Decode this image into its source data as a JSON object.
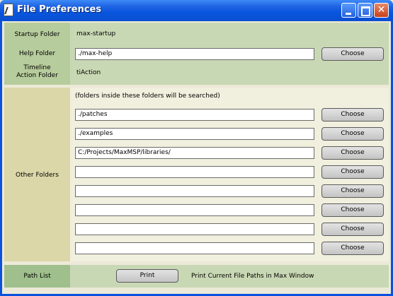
{
  "window": {
    "title": "File Preferences"
  },
  "startup": {
    "startup_folder_label": "Startup Folder",
    "startup_folder_value": "max-startup",
    "help_folder_label": "Help Folder",
    "help_folder_value": "./max-help",
    "help_choose_label": "Choose",
    "timeline_label_line1": "Timeline",
    "timeline_label_line2": "Action Folder",
    "timeline_value": "tiAction"
  },
  "other": {
    "label": "Other Folders",
    "note": "(folders inside these folders will be searched)",
    "choose_label": "Choose",
    "folders": [
      "./patches",
      "./examples",
      "C:/Projects/MaxMSP/libraries/",
      "",
      "",
      "",
      "",
      ""
    ]
  },
  "path_list": {
    "label": "Path List",
    "print_label": "Print",
    "description": "Print Current File Paths in Max Window"
  }
}
